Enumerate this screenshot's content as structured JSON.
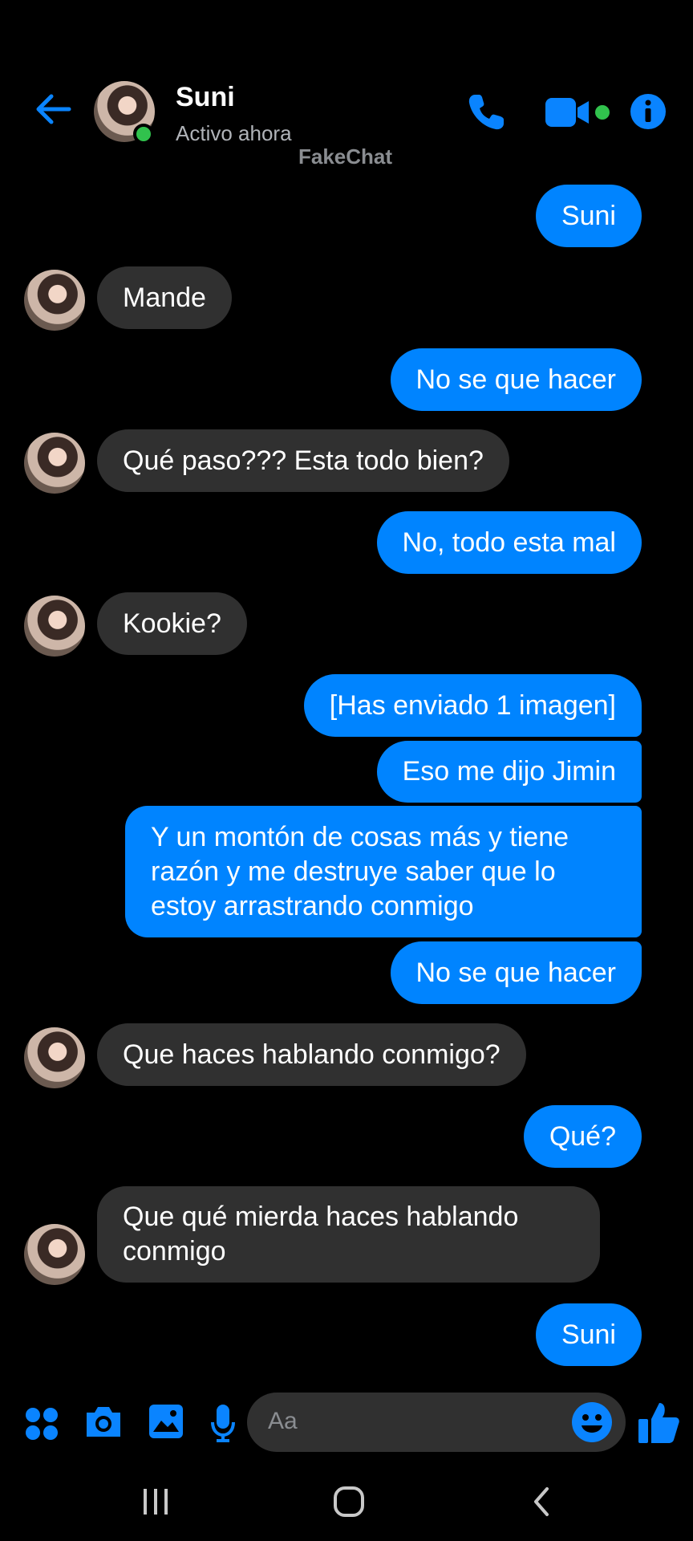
{
  "header": {
    "contact_name": "Suni",
    "status": "Activo ahora",
    "watermark": "FakeChat"
  },
  "messages": [
    {
      "direction": "outgoing",
      "text": "Suni"
    },
    {
      "direction": "incoming",
      "text": "Mande"
    },
    {
      "direction": "outgoing",
      "text": "No se que hacer"
    },
    {
      "direction": "incoming",
      "text": "Qué paso??? Esta todo bien?"
    },
    {
      "direction": "outgoing",
      "text": "No, todo esta mal"
    },
    {
      "direction": "incoming",
      "text": "Kookie?"
    },
    {
      "direction": "outgoing",
      "text": "[Has enviado 1 imagen]"
    },
    {
      "direction": "outgoing",
      "text": "Eso me dijo Jimin"
    },
    {
      "direction": "outgoing",
      "text": "Y un montón de cosas más y tiene razón y me destruye saber que lo estoy arrastrando conmigo"
    },
    {
      "direction": "outgoing",
      "text": "No se que hacer"
    },
    {
      "direction": "incoming",
      "text": "Que haces hablando conmigo?"
    },
    {
      "direction": "outgoing",
      "text": "Qué?"
    },
    {
      "direction": "incoming",
      "text": "Que qué mierda haces hablando conmigo"
    },
    {
      "direction": "outgoing",
      "text": "Suni"
    }
  ],
  "composer": {
    "placeholder": "Aa"
  },
  "colors": {
    "accent": "#0084ff",
    "incoming_bubble": "#303030",
    "online": "#31c24d",
    "background": "#000000"
  },
  "icons": [
    "back-arrow-icon",
    "phone-icon",
    "video-camera-icon",
    "info-icon",
    "apps-grid-icon",
    "camera-icon",
    "image-icon",
    "microphone-icon",
    "emoji-icon",
    "thumbs-up-icon",
    "recent-apps-icon",
    "home-icon",
    "nav-back-icon"
  ]
}
